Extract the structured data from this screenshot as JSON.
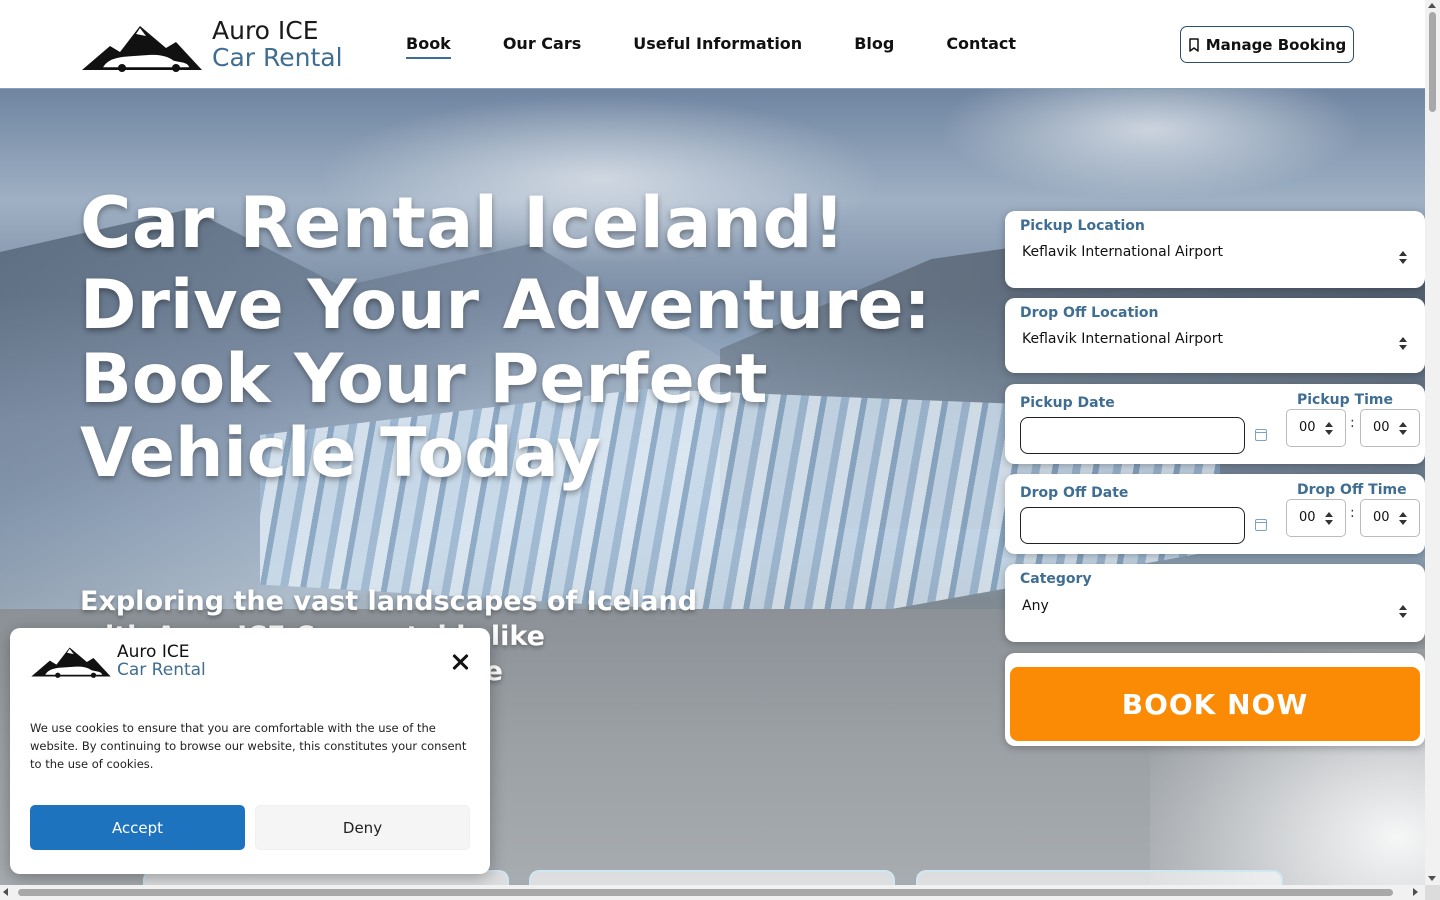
{
  "brand": {
    "line1": "Auro ICE",
    "line2": "Car Rental"
  },
  "nav": {
    "items": [
      {
        "label": "Book",
        "active": true
      },
      {
        "label": "Our Cars",
        "active": false
      },
      {
        "label": "Useful Information",
        "active": false
      },
      {
        "label": "Blog",
        "active": false
      },
      {
        "label": "Contact",
        "active": false
      }
    ],
    "manage_label": "Manage Booking",
    "manage_icon": "bookmark-icon"
  },
  "hero": {
    "title": "Car Rental Iceland!",
    "subtitle": "Drive Your Adventure: Book Your Perfect Vehicle Today",
    "intro": "Exploring the vast landscapes of Iceland with Auro ICE Car rental is like embarking on an adventure"
  },
  "form": {
    "pickup_location": {
      "label": "Pickup Location",
      "value": "Keflavik International Airport"
    },
    "dropoff_location": {
      "label": "Drop Off Location",
      "value": "Keflavik International Airport"
    },
    "pickup_date": {
      "label": "Pickup Date",
      "value": ""
    },
    "pickup_time": {
      "label": "Pickup Time",
      "hour": "00",
      "minute": "00"
    },
    "dropoff_date": {
      "label": "Drop Off Date",
      "value": ""
    },
    "dropoff_time": {
      "label": "Drop Off Time",
      "hour": "00",
      "minute": "00"
    },
    "category": {
      "label": "Category",
      "value": "Any"
    },
    "time_separator": ":",
    "submit_label": "BOOK NOW"
  },
  "cookie": {
    "brand_line1": "Auro ICE",
    "brand_line2": "Car Rental",
    "message": "We use cookies to ensure that you are comfortable with the use of the website. By continuing to browse our website, this constitutes your consent to the use of cookies.",
    "accept_label": "Accept",
    "deny_label": "Deny"
  },
  "colors": {
    "accent": "#3f6e92",
    "book_button": "#fb8a04",
    "accept_button": "#1e73be"
  }
}
